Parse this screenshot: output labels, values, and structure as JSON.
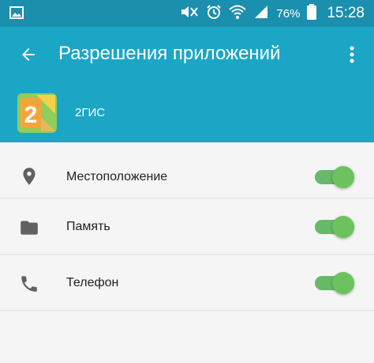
{
  "status_bar": {
    "icons": [
      "image-icon",
      "mute-icon",
      "alarm-icon",
      "wifi-icon",
      "signal-icon",
      "battery-icon"
    ],
    "battery_percent": "76%",
    "time": "15:28"
  },
  "app_bar": {
    "back_icon": "arrow-back-icon",
    "title": "Разрешения приложений",
    "overflow_icon": "more-vert-icon",
    "color": "#1ca6c6"
  },
  "app": {
    "name": "2ГИС",
    "logo_text": "2"
  },
  "permissions": [
    {
      "label": "Местоположение",
      "icon": "location-icon",
      "enabled": true
    },
    {
      "label": "Память",
      "icon": "folder-icon",
      "enabled": true
    },
    {
      "label": "Телефон",
      "icon": "phone-icon",
      "enabled": true
    }
  ],
  "colors": {
    "status_bar": "#1b8fae",
    "toggle_on": "#4caf50",
    "background": "#f5f5f5"
  }
}
